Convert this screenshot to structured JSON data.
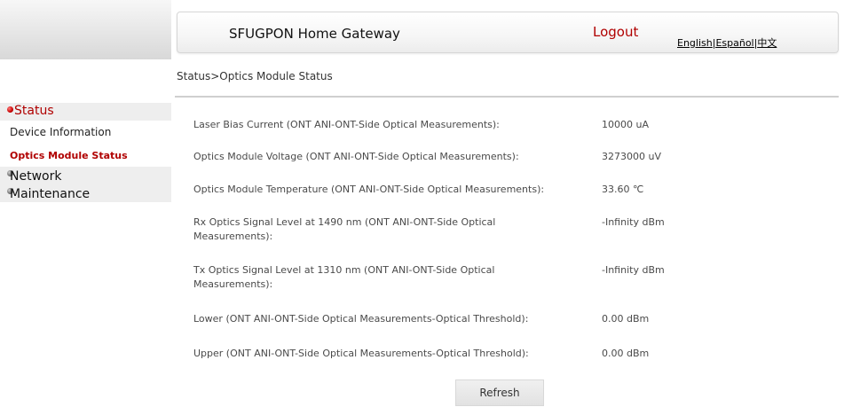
{
  "header": {
    "title": "SFUGPON Home Gateway",
    "logout_label": "Logout",
    "languages": [
      "English",
      "Español",
      "中文"
    ],
    "language_separator": "|"
  },
  "sidebar": {
    "status_label": "Status",
    "device_information_label": "Device Information",
    "optics_module_status_label": "Optics Module Status",
    "network_label": "Network",
    "maintenance_label": "Maintenance"
  },
  "breadcrumb": "Status>Optics Module Status",
  "measurements": [
    {
      "label": "Laser Bias Current (ONT ANI-ONT-Side Optical Measurements):",
      "value": "10000 uA"
    },
    {
      "label": "Optics Module Voltage (ONT ANI-ONT-Side Optical Measurements):",
      "value": "3273000 uV"
    },
    {
      "label": "Optics Module Temperature (ONT ANI-ONT-Side Optical Measurements):",
      "value": "33.60 ℃"
    },
    {
      "label": "Rx Optics Signal Level at 1490 nm (ONT ANI-ONT-Side Optical Measurements):",
      "value": "-Infinity dBm"
    },
    {
      "label": "Tx Optics Signal Level at 1310 nm (ONT ANI-ONT-Side Optical Measurements):",
      "value": "-Infinity dBm"
    },
    {
      "label": "Lower (ONT ANI-ONT-Side Optical Measurements-Optical Threshold):",
      "value": "0.00 dBm"
    },
    {
      "label": "Upper (ONT ANI-ONT-Side Optical Measurements-Optical Threshold):",
      "value": "0.00 dBm"
    }
  ],
  "refresh_label": "Refresh",
  "colors": {
    "accent_red": "#b00000",
    "menu_background": "#eeeeee",
    "divider": "#cfcfcf"
  },
  "icons": {
    "status_bullet": "red-bullet-icon",
    "network_bullet": "grey-bullet-icon",
    "maintenance_bullet": "grey-bullet-icon"
  }
}
